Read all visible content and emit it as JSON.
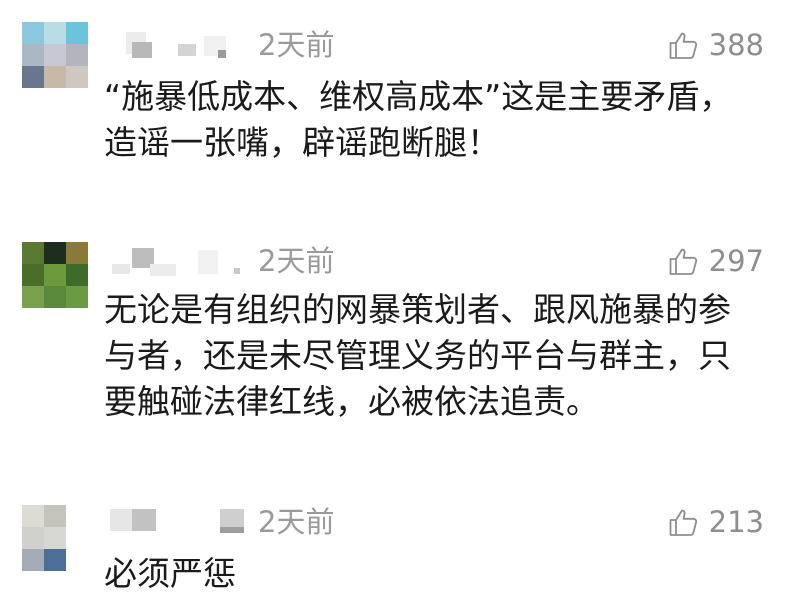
{
  "comments": [
    {
      "time": "2天前",
      "likes": "388",
      "text": "“施暴低成本、维权高成本”这是主要矛盾，\n造谣一张嘴，辟谣跑断腿！",
      "avatar_colors": [
        "#8cc8e0",
        "#b9dce6",
        "#6cc4dc",
        "#aab8c4",
        "#c8c8d4",
        "#b4b4bc",
        "#6a7690",
        "#c8b8a8",
        "#cfc8c0"
      ]
    },
    {
      "time": "2天前",
      "likes": "297",
      "text": "无论是有组织的网暴策划者、跟风施暴的参\n与者，还是未尽管理义务的平台与群主，只\n要触碰法律红线，必被依法追责。",
      "avatar_colors": [
        "#5a7a34",
        "#1e2e1e",
        "#8a7a3a",
        "#4a6e2a",
        "#6e9a3e",
        "#3e6a2a",
        "#7aa24e",
        "#5a8a3a",
        "#6a9a44"
      ]
    },
    {
      "time": "2天前",
      "likes": "213",
      "text": "必须严惩",
      "avatar_colors": [
        "#dcdcd4",
        "#c4c4bc",
        "#ffffff",
        "#d0d0cc",
        "#d8d8d2",
        "#ffffff",
        "#a4acb8",
        "#4e6e9a",
        "#ffffff"
      ]
    }
  ]
}
